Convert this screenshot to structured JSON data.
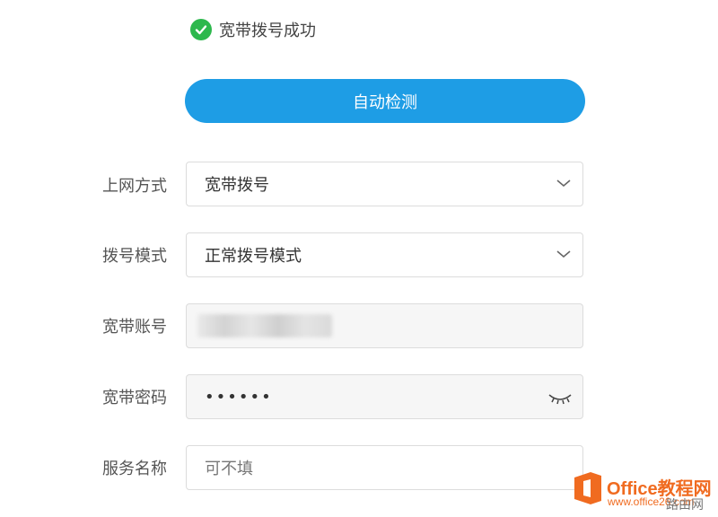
{
  "status": {
    "text": "宽带拨号成功",
    "icon": "check-circle-icon",
    "color": "#2db84d"
  },
  "detect_button": {
    "label": "自动检测",
    "color": "#1e9de5"
  },
  "form": {
    "connection_type": {
      "label": "上网方式",
      "value": "宽带拨号"
    },
    "dial_mode": {
      "label": "拨号模式",
      "value": "正常拨号模式"
    },
    "account": {
      "label": "宽带账号",
      "value": ""
    },
    "password": {
      "label": "宽带密码",
      "value": "••••••"
    },
    "service_name": {
      "label": "服务名称",
      "placeholder": "可不填",
      "value": ""
    }
  },
  "branding": {
    "title": "Office教程网",
    "url": "www.office26.com",
    "watermark": "路由网"
  }
}
